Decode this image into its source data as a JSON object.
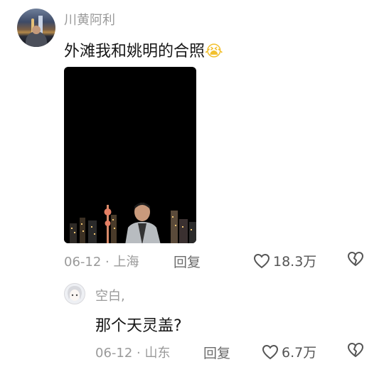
{
  "comment": {
    "username": "川黄阿利",
    "text": "外滩我和姚明的合照",
    "emoji": "😭",
    "date": "06-12",
    "separator": "·",
    "location": "上海",
    "reply_label": "回复",
    "likes": "18.3万"
  },
  "reply": {
    "username": "空白,",
    "text": "那个天灵盖?",
    "date": "06-12",
    "separator": "·",
    "location": "山东",
    "reply_label": "回复",
    "likes": "6.7万"
  },
  "icons": {
    "like": "heart-outline-icon",
    "dislike": "broken-heart-outline-icon"
  }
}
